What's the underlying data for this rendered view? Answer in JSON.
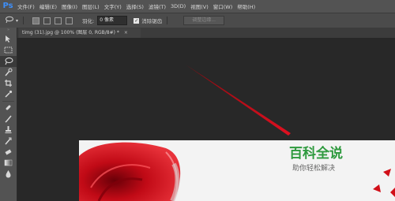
{
  "app": {
    "logo": "Ps"
  },
  "menubar": {
    "items": [
      "文件(F)",
      "编辑(E)",
      "图像(I)",
      "图层(L)",
      "文字(Y)",
      "选择(S)",
      "滤镜(T)",
      "3D(D)",
      "视图(V)",
      "窗口(W)",
      "帮助(H)"
    ]
  },
  "options": {
    "feather_label": "羽化:",
    "feather_value": "0 像素",
    "antialias_label": "消除锯齿",
    "refine_label": "调整边缘..."
  },
  "document": {
    "tab_title": "timg (31).jpg @ 100% (图层 0, RGB/8#) *",
    "tab_close": "×"
  },
  "watermark": {
    "title": "百科全说",
    "subtitle": "助你轻松解决"
  },
  "colors": {
    "accent_red": "#d0101a",
    "watermark_green": "#2e9a3e",
    "ps_blue": "#3e8ef7"
  },
  "icons": {
    "toolbox": [
      "move-icon",
      "marquee-icon",
      "lasso-icon",
      "quick-select-icon",
      "crop-icon",
      "eyedropper-icon",
      "healing-brush-icon",
      "brush-icon",
      "clone-stamp-icon",
      "history-brush-icon",
      "eraser-icon",
      "gradient-icon",
      "blur-icon"
    ]
  }
}
